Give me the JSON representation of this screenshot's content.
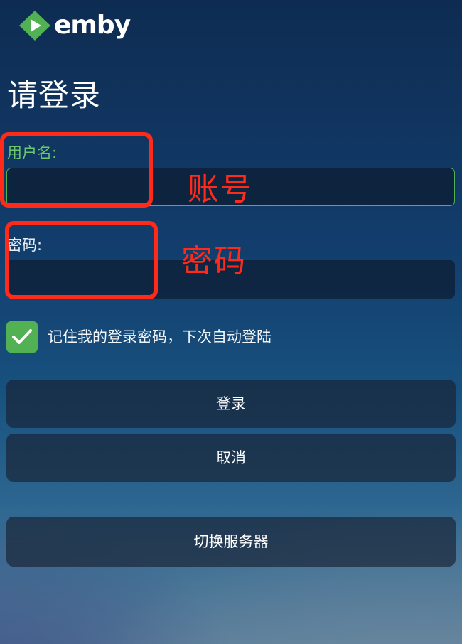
{
  "app": {
    "brand": "emby",
    "brand_color": "#52b152"
  },
  "page": {
    "title": "请登录"
  },
  "form": {
    "username_label": "用户名:",
    "username_value": "",
    "password_label": "密码:",
    "password_value": "",
    "remember_label": "记住我的登录密码，下次自动登陆",
    "remember_checked": true
  },
  "buttons": {
    "login": "登录",
    "cancel": "取消",
    "switch_server": "切换服务器"
  },
  "annotations": {
    "username": "账号",
    "password": "密码",
    "color": "#ff2a1a"
  },
  "icons": {
    "logo": "emby-play-diamond-icon",
    "checkbox": "checkmark-icon"
  }
}
